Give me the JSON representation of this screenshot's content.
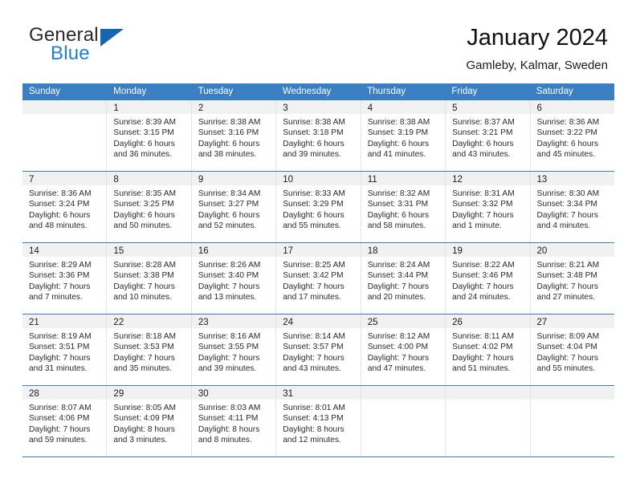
{
  "brand": {
    "word_one": "General",
    "word_two": "Blue",
    "flag_icon": "triangle-flag-icon"
  },
  "header": {
    "title": "January 2024",
    "subtitle": "Gamleby, Kalmar, Sweden"
  },
  "theme": {
    "header_blue": "#3a7fc1",
    "brand_blue": "#1c7fd4",
    "flag_blue": "#1565b0",
    "daynum_bg": "#f1f1f1",
    "cell_border": "#e3e3e3"
  },
  "weekdays": [
    "Sunday",
    "Monday",
    "Tuesday",
    "Wednesday",
    "Thursday",
    "Friday",
    "Saturday"
  ],
  "weeks": [
    [
      {
        "day": "",
        "lines": []
      },
      {
        "day": "1",
        "lines": [
          "Sunrise: 8:39 AM",
          "Sunset: 3:15 PM",
          "Daylight: 6 hours",
          "and 36 minutes."
        ]
      },
      {
        "day": "2",
        "lines": [
          "Sunrise: 8:38 AM",
          "Sunset: 3:16 PM",
          "Daylight: 6 hours",
          "and 38 minutes."
        ]
      },
      {
        "day": "3",
        "lines": [
          "Sunrise: 8:38 AM",
          "Sunset: 3:18 PM",
          "Daylight: 6 hours",
          "and 39 minutes."
        ]
      },
      {
        "day": "4",
        "lines": [
          "Sunrise: 8:38 AM",
          "Sunset: 3:19 PM",
          "Daylight: 6 hours",
          "and 41 minutes."
        ]
      },
      {
        "day": "5",
        "lines": [
          "Sunrise: 8:37 AM",
          "Sunset: 3:21 PM",
          "Daylight: 6 hours",
          "and 43 minutes."
        ]
      },
      {
        "day": "6",
        "lines": [
          "Sunrise: 8:36 AM",
          "Sunset: 3:22 PM",
          "Daylight: 6 hours",
          "and 45 minutes."
        ]
      }
    ],
    [
      {
        "day": "7",
        "lines": [
          "Sunrise: 8:36 AM",
          "Sunset: 3:24 PM",
          "Daylight: 6 hours",
          "and 48 minutes."
        ]
      },
      {
        "day": "8",
        "lines": [
          "Sunrise: 8:35 AM",
          "Sunset: 3:25 PM",
          "Daylight: 6 hours",
          "and 50 minutes."
        ]
      },
      {
        "day": "9",
        "lines": [
          "Sunrise: 8:34 AM",
          "Sunset: 3:27 PM",
          "Daylight: 6 hours",
          "and 52 minutes."
        ]
      },
      {
        "day": "10",
        "lines": [
          "Sunrise: 8:33 AM",
          "Sunset: 3:29 PM",
          "Daylight: 6 hours",
          "and 55 minutes."
        ]
      },
      {
        "day": "11",
        "lines": [
          "Sunrise: 8:32 AM",
          "Sunset: 3:31 PM",
          "Daylight: 6 hours",
          "and 58 minutes."
        ]
      },
      {
        "day": "12",
        "lines": [
          "Sunrise: 8:31 AM",
          "Sunset: 3:32 PM",
          "Daylight: 7 hours",
          "and 1 minute."
        ]
      },
      {
        "day": "13",
        "lines": [
          "Sunrise: 8:30 AM",
          "Sunset: 3:34 PM",
          "Daylight: 7 hours",
          "and 4 minutes."
        ]
      }
    ],
    [
      {
        "day": "14",
        "lines": [
          "Sunrise: 8:29 AM",
          "Sunset: 3:36 PM",
          "Daylight: 7 hours",
          "and 7 minutes."
        ]
      },
      {
        "day": "15",
        "lines": [
          "Sunrise: 8:28 AM",
          "Sunset: 3:38 PM",
          "Daylight: 7 hours",
          "and 10 minutes."
        ]
      },
      {
        "day": "16",
        "lines": [
          "Sunrise: 8:26 AM",
          "Sunset: 3:40 PM",
          "Daylight: 7 hours",
          "and 13 minutes."
        ]
      },
      {
        "day": "17",
        "lines": [
          "Sunrise: 8:25 AM",
          "Sunset: 3:42 PM",
          "Daylight: 7 hours",
          "and 17 minutes."
        ]
      },
      {
        "day": "18",
        "lines": [
          "Sunrise: 8:24 AM",
          "Sunset: 3:44 PM",
          "Daylight: 7 hours",
          "and 20 minutes."
        ]
      },
      {
        "day": "19",
        "lines": [
          "Sunrise: 8:22 AM",
          "Sunset: 3:46 PM",
          "Daylight: 7 hours",
          "and 24 minutes."
        ]
      },
      {
        "day": "20",
        "lines": [
          "Sunrise: 8:21 AM",
          "Sunset: 3:48 PM",
          "Daylight: 7 hours",
          "and 27 minutes."
        ]
      }
    ],
    [
      {
        "day": "21",
        "lines": [
          "Sunrise: 8:19 AM",
          "Sunset: 3:51 PM",
          "Daylight: 7 hours",
          "and 31 minutes."
        ]
      },
      {
        "day": "22",
        "lines": [
          "Sunrise: 8:18 AM",
          "Sunset: 3:53 PM",
          "Daylight: 7 hours",
          "and 35 minutes."
        ]
      },
      {
        "day": "23",
        "lines": [
          "Sunrise: 8:16 AM",
          "Sunset: 3:55 PM",
          "Daylight: 7 hours",
          "and 39 minutes."
        ]
      },
      {
        "day": "24",
        "lines": [
          "Sunrise: 8:14 AM",
          "Sunset: 3:57 PM",
          "Daylight: 7 hours",
          "and 43 minutes."
        ]
      },
      {
        "day": "25",
        "lines": [
          "Sunrise: 8:12 AM",
          "Sunset: 4:00 PM",
          "Daylight: 7 hours",
          "and 47 minutes."
        ]
      },
      {
        "day": "26",
        "lines": [
          "Sunrise: 8:11 AM",
          "Sunset: 4:02 PM",
          "Daylight: 7 hours",
          "and 51 minutes."
        ]
      },
      {
        "day": "27",
        "lines": [
          "Sunrise: 8:09 AM",
          "Sunset: 4:04 PM",
          "Daylight: 7 hours",
          "and 55 minutes."
        ]
      }
    ],
    [
      {
        "day": "28",
        "lines": [
          "Sunrise: 8:07 AM",
          "Sunset: 4:06 PM",
          "Daylight: 7 hours",
          "and 59 minutes."
        ]
      },
      {
        "day": "29",
        "lines": [
          "Sunrise: 8:05 AM",
          "Sunset: 4:09 PM",
          "Daylight: 8 hours",
          "and 3 minutes."
        ]
      },
      {
        "day": "30",
        "lines": [
          "Sunrise: 8:03 AM",
          "Sunset: 4:11 PM",
          "Daylight: 8 hours",
          "and 8 minutes."
        ]
      },
      {
        "day": "31",
        "lines": [
          "Sunrise: 8:01 AM",
          "Sunset: 4:13 PM",
          "Daylight: 8 hours",
          "and 12 minutes."
        ]
      },
      {
        "day": "",
        "lines": []
      },
      {
        "day": "",
        "lines": []
      },
      {
        "day": "",
        "lines": []
      }
    ]
  ]
}
